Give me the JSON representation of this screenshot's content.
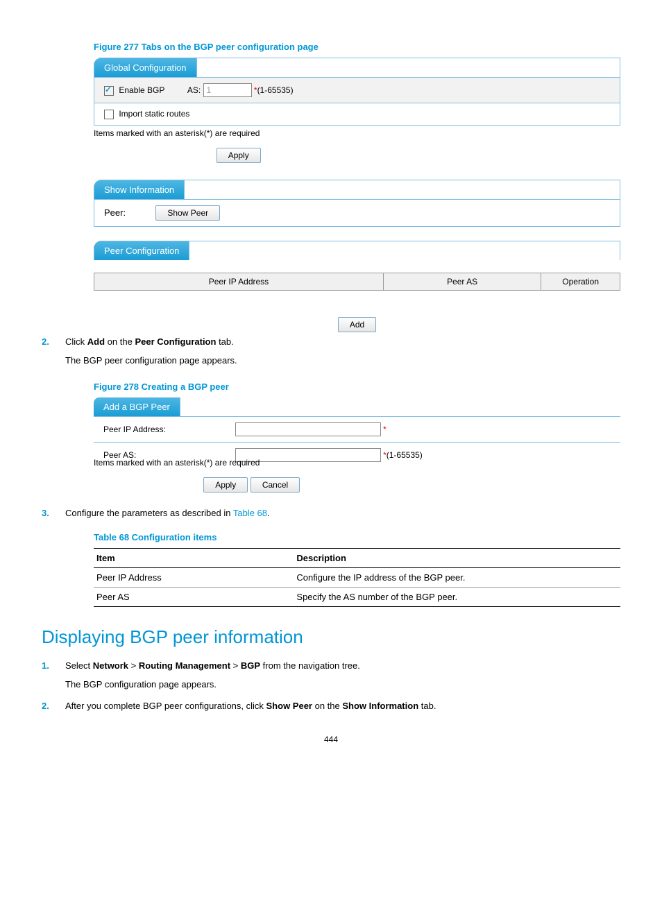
{
  "fig277": {
    "caption": "Figure 277 Tabs on the BGP peer configuration page",
    "global": {
      "tab": "Global Configuration",
      "enable_label": "Enable BGP",
      "enable_checked": true,
      "as_label": "AS:",
      "as_value": "1",
      "as_hint": "(1-65535)",
      "import_label": "Import static routes",
      "import_checked": false,
      "required_note": "Items marked with an asterisk(*) are required",
      "apply": "Apply"
    },
    "show": {
      "tab": "Show Information",
      "peer_label": "Peer:",
      "show_peer": "Show Peer"
    },
    "peer": {
      "tab": "Peer Configuration",
      "cols": [
        "Peer IP Address",
        "Peer AS",
        "Operation"
      ],
      "add": "Add"
    }
  },
  "step2": {
    "num": "2.",
    "text_prefix": "Click ",
    "bold1": "Add",
    "text_mid": " on the ",
    "bold2": "Peer Configuration",
    "text_suffix": " tab.",
    "sub": "The BGP peer configuration page appears."
  },
  "fig278": {
    "caption": "Figure 278 Creating a BGP peer",
    "tab": "Add a BGP Peer",
    "ip_label": "Peer IP Address:",
    "as_label": "Peer AS:",
    "as_hint": "(1-65535)",
    "required_note": "Items marked with an asterisk(*) are required",
    "apply": "Apply",
    "cancel": "Cancel"
  },
  "step3": {
    "num": "3.",
    "text_prefix": "Configure the parameters as described in ",
    "link": "Table 68",
    "text_suffix": "."
  },
  "table68": {
    "caption": "Table 68 Configuration items",
    "head": [
      "Item",
      "Description"
    ],
    "rows": [
      [
        "Peer IP Address",
        "Configure the IP address of the BGP peer."
      ],
      [
        "Peer AS",
        "Specify the AS number of the BGP peer."
      ]
    ]
  },
  "section_title": "Displaying BGP peer information",
  "disp_steps": [
    {
      "num": "1.",
      "pre": "Select ",
      "b1": "Network",
      "gt1": " > ",
      "b2": "Routing Management",
      "gt2": " > ",
      "b3": "BGP",
      "post": " from the navigation tree.",
      "sub": "The BGP configuration page appears."
    },
    {
      "num": "2.",
      "pre": "After you complete BGP peer configurations, click ",
      "b1": "Show Peer",
      "mid": " on the ",
      "b2": "Show Information",
      "post": " tab."
    }
  ],
  "page_number": "444"
}
